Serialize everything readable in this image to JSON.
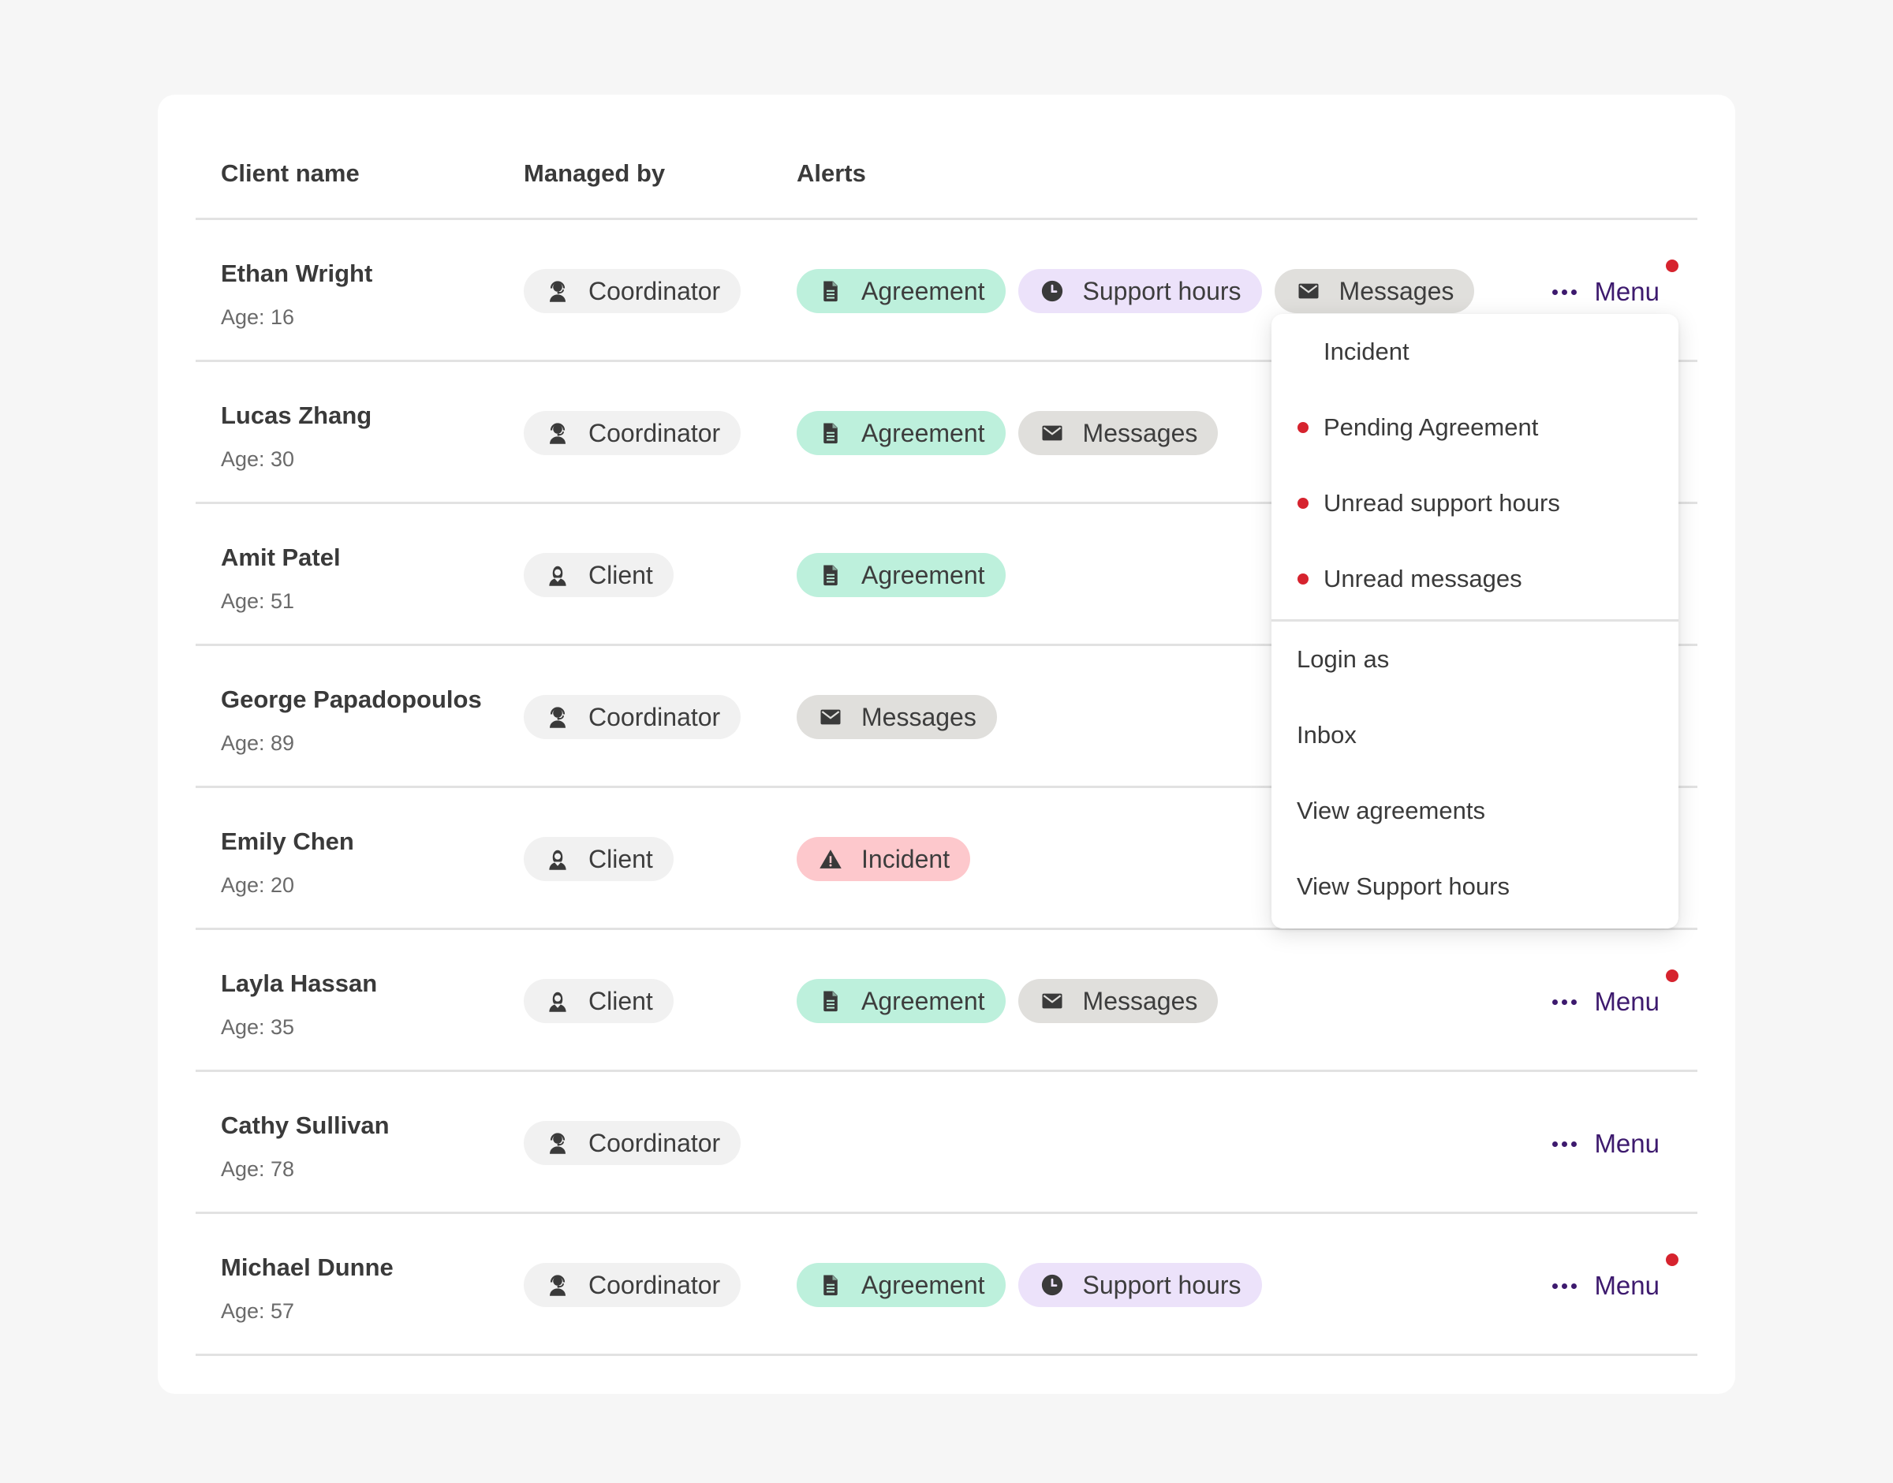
{
  "table": {
    "headers": {
      "client_name": "Client name",
      "managed_by": "Managed by",
      "alerts": "Alerts"
    },
    "rows": [
      {
        "name": "Ethan Wright",
        "age": "Age: 16",
        "managed_by": "Coordinator",
        "managed_icon": "headset-person-icon",
        "alerts": [
          {
            "label": "Agreement",
            "type": "agreement"
          },
          {
            "label": "Support hours",
            "type": "support"
          },
          {
            "label": "Messages",
            "type": "messages"
          }
        ],
        "menu": {
          "label": "Menu",
          "has_badge": true,
          "visible": true
        }
      },
      {
        "name": "Lucas Zhang",
        "age": "Age: 30",
        "managed_by": "Coordinator",
        "managed_icon": "headset-person-icon",
        "alerts": [
          {
            "label": "Agreement",
            "type": "agreement"
          },
          {
            "label": "Messages",
            "type": "messages"
          }
        ],
        "menu": {
          "label": "Menu",
          "has_badge": false,
          "visible": false
        }
      },
      {
        "name": "Amit Patel",
        "age": "Age: 51",
        "managed_by": "Client",
        "managed_icon": "person-icon",
        "alerts": [
          {
            "label": "Agreement",
            "type": "agreement"
          }
        ],
        "menu": {
          "label": "Menu",
          "has_badge": false,
          "visible": false
        }
      },
      {
        "name": "George Papadopoulos",
        "age": "Age: 89",
        "managed_by": "Coordinator",
        "managed_icon": "headset-person-icon",
        "alerts": [
          {
            "label": "Messages",
            "type": "messages"
          }
        ],
        "menu": {
          "label": "Menu",
          "has_badge": false,
          "visible": false
        }
      },
      {
        "name": "Emily Chen",
        "age": "Age: 20",
        "managed_by": "Client",
        "managed_icon": "person-icon",
        "alerts": [
          {
            "label": "Incident",
            "type": "incident"
          }
        ],
        "menu": {
          "label": "Menu",
          "has_badge": false,
          "visible": false
        }
      },
      {
        "name": "Layla Hassan",
        "age": "Age: 35",
        "managed_by": "Client",
        "managed_icon": "person-icon",
        "alerts": [
          {
            "label": "Agreement",
            "type": "agreement"
          },
          {
            "label": "Messages",
            "type": "messages"
          }
        ],
        "menu": {
          "label": "Menu",
          "has_badge": true,
          "visible": true
        }
      },
      {
        "name": "Cathy Sullivan",
        "age": "Age: 78",
        "managed_by": "Coordinator",
        "managed_icon": "headset-person-icon",
        "alerts": [],
        "menu": {
          "label": "Menu",
          "has_badge": false,
          "visible": true
        }
      },
      {
        "name": "Michael Dunne",
        "age": "Age: 57",
        "managed_by": "Coordinator",
        "managed_icon": "headset-person-icon",
        "alerts": [
          {
            "label": "Agreement",
            "type": "agreement"
          },
          {
            "label": "Support hours",
            "type": "support"
          }
        ],
        "menu": {
          "label": "Menu",
          "has_badge": true,
          "visible": true
        }
      }
    ]
  },
  "dropdown": {
    "alert_items": [
      {
        "label": "Incident",
        "unread": false
      },
      {
        "label": "Pending Agreement",
        "unread": true
      },
      {
        "label": "Unread support hours",
        "unread": true
      },
      {
        "label": "Unread messages",
        "unread": true
      }
    ],
    "action_items": [
      {
        "label": "Login as"
      },
      {
        "label": "Inbox"
      },
      {
        "label": "View agreements"
      },
      {
        "label": "View Support hours"
      }
    ]
  },
  "colors": {
    "agreement": "#bdf0dc",
    "support": "#ece2fa",
    "messages": "#e0dfdc",
    "incident": "#fdc8cc",
    "menu_accent": "#3d1a6e",
    "badge_red": "#d6232e"
  }
}
